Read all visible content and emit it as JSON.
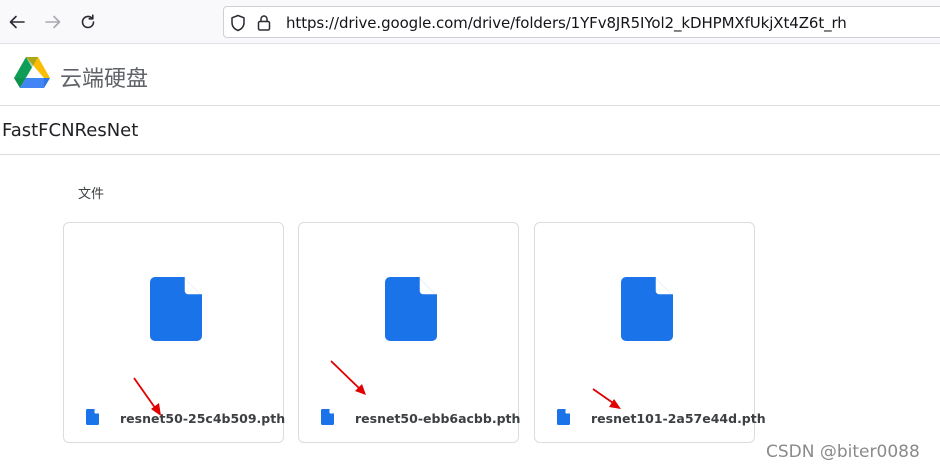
{
  "browser": {
    "url": "https://drive.google.com/drive/folders/1YFv8JR5IYol2_kDHPMXfUkjXt4Z6t_rh"
  },
  "app": {
    "name": "云端硬盘"
  },
  "folder": {
    "title": "FastFCNResNet"
  },
  "section": {
    "label": "文件"
  },
  "files": [
    {
      "name": "resnet50-25c4b509.pth"
    },
    {
      "name": "resnet50-ebb6acbb.pth"
    },
    {
      "name": "resnet101-2a57e44d.pth"
    }
  ],
  "watermark": "CSDN @biter0088",
  "colors": {
    "file_icon": "#1a73e8",
    "annotation_arrow": "#e00000"
  }
}
